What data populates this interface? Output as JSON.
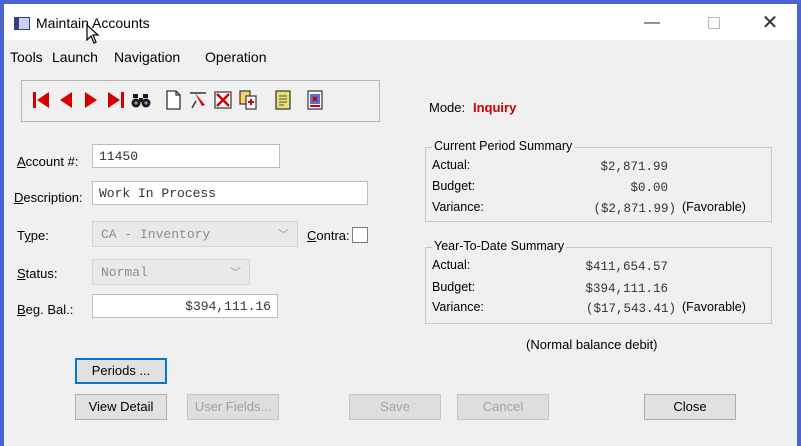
{
  "window": {
    "title": "Maintain Accounts",
    "controls": {
      "minimize": "—",
      "close": "✕"
    }
  },
  "menu": [
    "Tools",
    "Launch",
    "Navigation",
    "Operation"
  ],
  "toolbar": {
    "buttons": [
      "first-record-icon",
      "previous-record-icon",
      "next-record-icon",
      "last-record-icon",
      "binoculars-icon",
      "new-document-icon",
      "pin-icon",
      "delete-icon",
      "copy-icon",
      "notes-icon",
      "report-icon"
    ]
  },
  "mode": {
    "label": "Mode:",
    "value": "Inquiry",
    "color": "#cc0000"
  },
  "form": {
    "account_label": "Account #:",
    "account_value": "11450",
    "description_label": "Description:",
    "description_value": "Work In Process",
    "type_label": "Type:",
    "type_value": "CA - Inventory",
    "contra_label": "Contra:",
    "status_label": "Status:",
    "status_value": "Normal",
    "beg_bal_label": "Beg. Bal.:",
    "beg_bal_value": "$394,111.16"
  },
  "current_period": {
    "title": "Current Period Summary",
    "actual_label": "Actual:",
    "actual_value": "$2,871.99",
    "budget_label": "Budget:",
    "budget_value": "$0.00",
    "variance_label": "Variance:",
    "variance_value": "($2,871.99)",
    "variance_note": "(Favorable)"
  },
  "ytd": {
    "title": "Year-To-Date Summary",
    "actual_label": "Actual:",
    "actual_value": "$411,654.57",
    "budget_label": "Budget:",
    "budget_value": "$394,111.16",
    "variance_label": "Variance:",
    "variance_value": "($17,543.41)",
    "variance_note": "(Favorable)"
  },
  "balance_note": "(Normal balance debit)",
  "buttons": {
    "periods": "Periods ...",
    "view_detail": "View Detail",
    "user_fields": "User Fields...",
    "save": "Save",
    "cancel": "Cancel",
    "close": "Close"
  },
  "colors": {
    "background": "#4a64cf",
    "focus": "#0078d7",
    "toolbar_red": "#d40000"
  }
}
